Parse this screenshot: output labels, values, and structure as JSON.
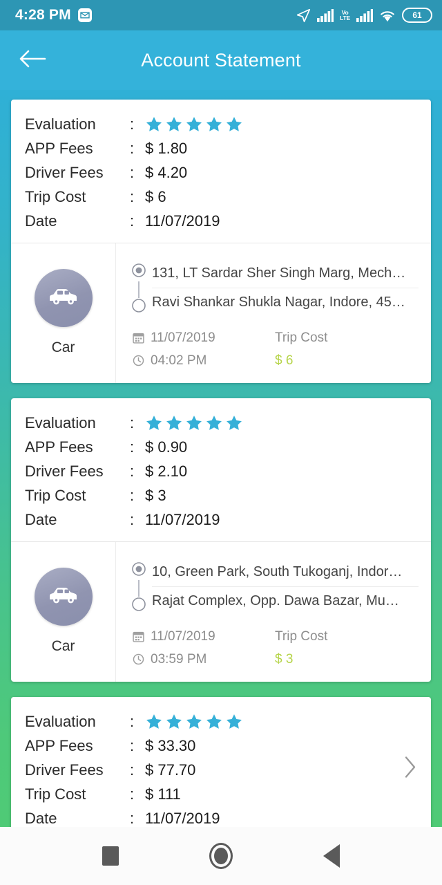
{
  "status_bar": {
    "time": "4:28 PM",
    "notification_icon": "message-icon",
    "location_icon": "location-arrow-icon",
    "signal_icon_1": "signal-bars-icon",
    "volte_top": "Vo",
    "volte_bottom": "LTE",
    "signal_icon_2": "signal-bars-icon",
    "wifi_icon": "wifi-icon",
    "battery_level": "61"
  },
  "app_bar": {
    "back_icon": "back-arrow-icon",
    "title": "Account Statement"
  },
  "labels": {
    "evaluation": "Evaluation",
    "app_fees": "APP Fees",
    "driver_fees": "Driver Fees",
    "trip_cost": "Trip Cost",
    "date": "Date",
    "colon": ":",
    "trip_cost_heading": "Trip Cost"
  },
  "colors": {
    "header": "#34b2da",
    "status_bar": "#2d96b4",
    "star": "#35b0d8",
    "trip_cost": "#b6d44a",
    "gradient_top": "#2fb0d6",
    "gradient_bottom": "#4fca76"
  },
  "cards": [
    {
      "rating": 5,
      "app_fees": "$ 1.80",
      "driver_fees": "$ 4.20",
      "trip_cost": "$ 6",
      "date": "11/07/2019",
      "has_trip_details": true,
      "has_chevron": false,
      "vehicle": {
        "icon": "car-icon",
        "label": "Car"
      },
      "pickup": "131, LT Sardar Sher Singh Marg, Mech…",
      "dropoff": "Ravi Shankar Shukla Nagar, Indore, 45…",
      "trip_date": "11/07/2019",
      "trip_time": "04:02 PM",
      "trip_cost_value": "$ 6"
    },
    {
      "rating": 5,
      "app_fees": "$ 0.90",
      "driver_fees": "$ 2.10",
      "trip_cost": "$ 3",
      "date": "11/07/2019",
      "has_trip_details": true,
      "has_chevron": false,
      "vehicle": {
        "icon": "car-icon",
        "label": "Car"
      },
      "pickup": "10, Green Park, South Tukoganj, Indor…",
      "dropoff": "Rajat Complex, Opp. Dawa Bazar, Mu…",
      "trip_date": "11/07/2019",
      "trip_time": "03:59 PM",
      "trip_cost_value": "$ 3"
    },
    {
      "rating": 5,
      "app_fees": "$ 33.30",
      "driver_fees": "$ 77.70",
      "trip_cost": "$ 111",
      "date": "11/07/2019",
      "has_trip_details": false,
      "has_chevron": true,
      "chevron_icon": "chevron-right-icon"
    }
  ],
  "nav_bar": {
    "recents": "recents-square-icon",
    "home": "home-circle-icon",
    "back": "back-triangle-icon"
  }
}
